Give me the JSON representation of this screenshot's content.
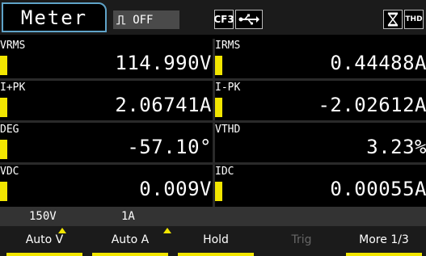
{
  "header": {
    "tab_label": "Meter",
    "hold_icon": "hold-icon",
    "hold_status": "OFF",
    "cf_icon_text": "CF3",
    "usb_icon": "usb-icon",
    "hourglass_icon": "hourglass-icon",
    "thd_icon_text": "THD"
  },
  "measurements": [
    {
      "label": "VRMS",
      "value": "114.990V"
    },
    {
      "label": "IRMS",
      "value": "0.44488A"
    },
    {
      "label": "I+PK",
      "value": "2.06741A"
    },
    {
      "label": "I-PK",
      "value": "-2.02612A"
    },
    {
      "label": "DEG",
      "value": "-57.10°"
    },
    {
      "label": "VTHD",
      "value": "3.23%"
    },
    {
      "label": "VDC",
      "value": "0.009V"
    },
    {
      "label": "IDC",
      "value": "0.00055A"
    }
  ],
  "status": {
    "voltage_range": "150V",
    "current_range": "1A"
  },
  "softkeys": [
    {
      "label": "Auto V",
      "enabled": true
    },
    {
      "label": "Auto A",
      "enabled": true
    },
    {
      "label": "Hold",
      "enabled": true
    },
    {
      "label": "Trig",
      "enabled": false
    },
    {
      "label": "More 1/3",
      "enabled": true
    }
  ],
  "colors": {
    "indicator": "#f2e600",
    "tab_border": "#5fa3c8",
    "background": "#000000"
  }
}
